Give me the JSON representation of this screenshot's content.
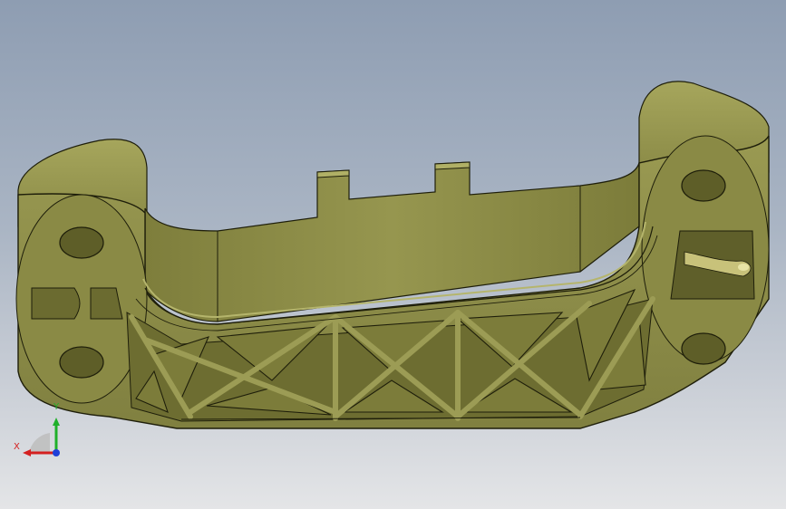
{
  "triad": {
    "x_label": "X",
    "y_label": "Y",
    "x_color": "#d42020",
    "y_color": "#1fb02a",
    "z_color": "#1f3fd8"
  },
  "colors": {
    "part_face": "#8f8f4c",
    "part_face_light": "#a3a35a",
    "part_face_dark": "#6a6a30",
    "part_shadow": "#55551f",
    "edge": "#1e1e0a",
    "highlight": "#e8e39a"
  }
}
